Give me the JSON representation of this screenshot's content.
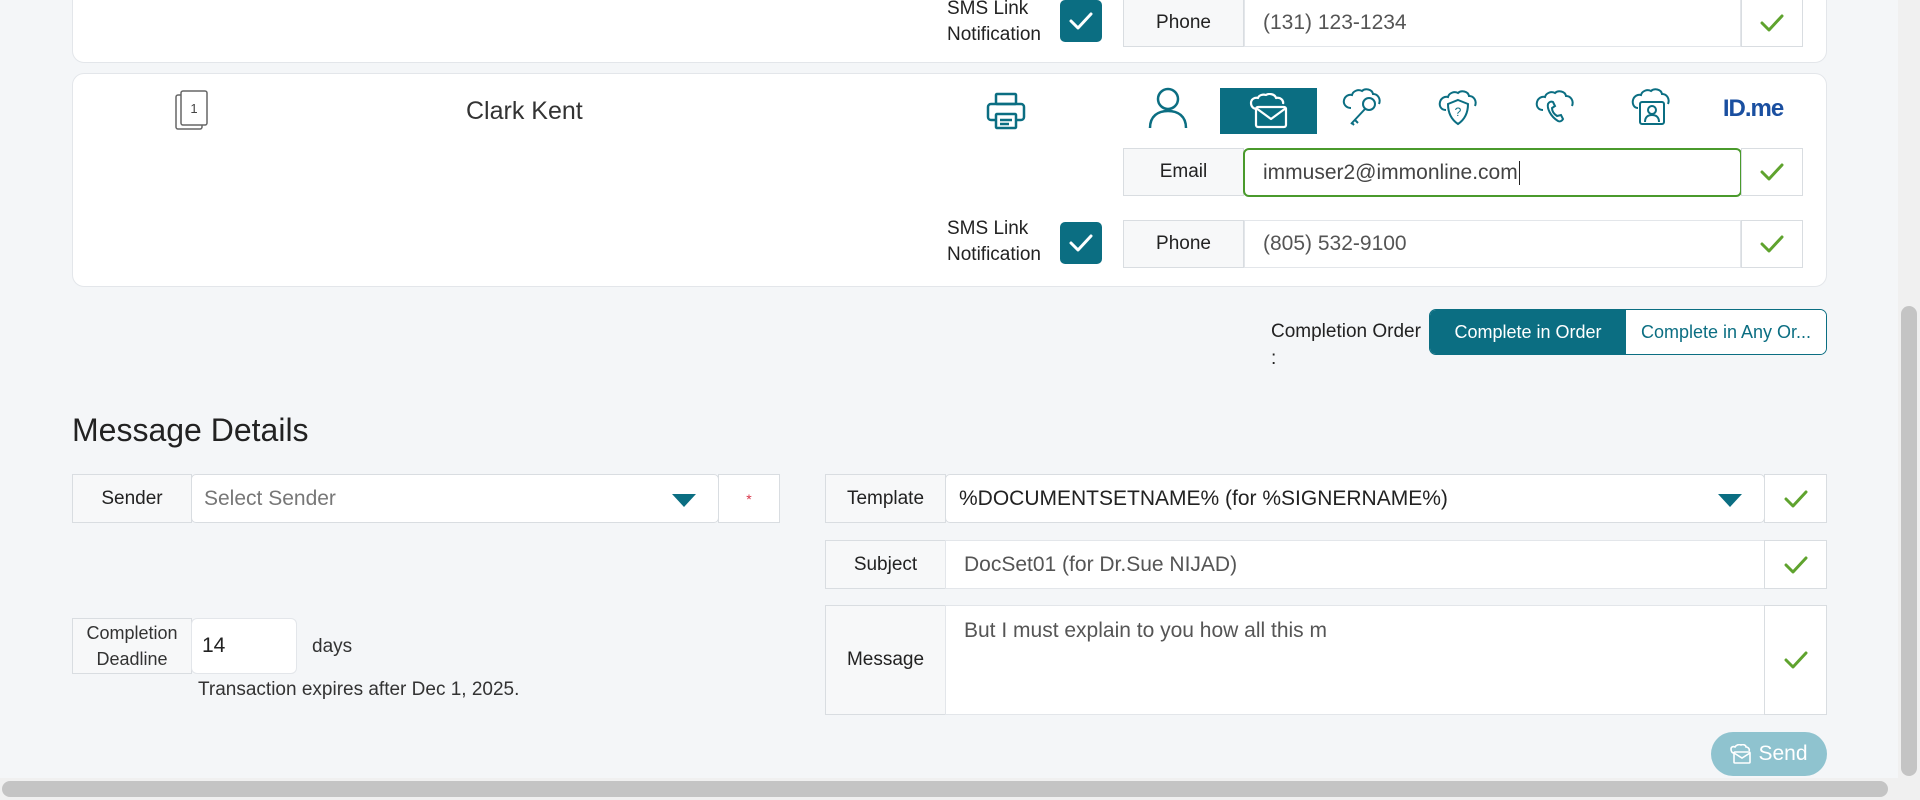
{
  "signer_prev": {
    "sms_label": "SMS Link Notification",
    "phone_label": "Phone",
    "phone_value": "(131) 123-1234"
  },
  "signer": {
    "doc_number": "1",
    "name": "Clark Kent",
    "idme_label": "ID.me",
    "email_label": "Email",
    "email_value": "immuser2@immonline.com",
    "sms_label": "SMS Link Notification",
    "phone_label": "Phone",
    "phone_value": "(805) 532-9100"
  },
  "completion_order": {
    "label": "Completion Order :",
    "option_in_order": "Complete in Order",
    "option_any_order": "Complete in Any Or..."
  },
  "message_details": {
    "title": "Message Details",
    "sender_label": "Sender",
    "sender_placeholder": "Select Sender",
    "required_marker": "*",
    "template_label": "Template",
    "template_value": "%DOCUMENTSETNAME% (for %SIGNERNAME%)",
    "subject_label": "Subject",
    "subject_value": "DocSet01 (for Dr.Sue NIJAD)",
    "message_label": "Message",
    "message_value": "But I must explain to you how all this m",
    "deadline_label": "Completion Deadline",
    "deadline_value": "14",
    "deadline_unit": "days",
    "expiry_note": "Transaction expires after Dec 1, 2025.",
    "send_label": "Send"
  },
  "colors": {
    "accent": "#0b6e82",
    "check_green": "#5fa32e",
    "email_focus_border": "#4a9a2c",
    "send_button": "#8fc3cf"
  }
}
